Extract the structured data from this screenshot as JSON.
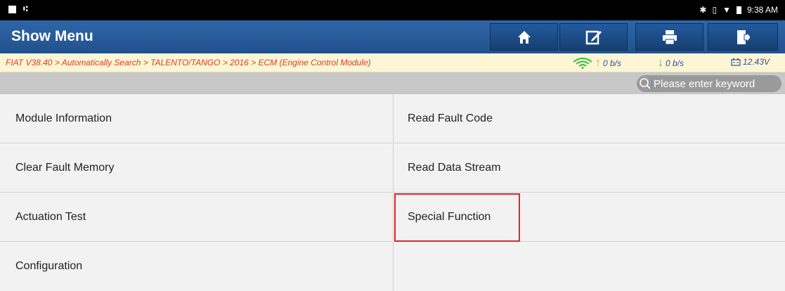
{
  "statusbar": {
    "time": "9:38 AM"
  },
  "header": {
    "title": "Show Menu",
    "buttons": [
      {
        "name": "home",
        "icon": "home-icon"
      },
      {
        "name": "edit",
        "icon": "edit-icon"
      },
      {
        "name": "print",
        "icon": "printer-icon"
      },
      {
        "name": "exit",
        "icon": "exit-icon"
      }
    ]
  },
  "breadcrumb": "FIAT V38.40 > Automatically Search > TALENTO/TANGO > 2016 > ECM (Engine Control Module)",
  "network": {
    "upload": "0 b/s",
    "download": "0 b/s",
    "voltage": "12.43V"
  },
  "search": {
    "placeholder": "Please enter keyword"
  },
  "menu": {
    "items": [
      {
        "label": "Module Information"
      },
      {
        "label": "Read Fault Code"
      },
      {
        "label": "Clear Fault Memory"
      },
      {
        "label": "Read Data Stream"
      },
      {
        "label": "Actuation Test"
      },
      {
        "label": "Special Function"
      },
      {
        "label": "Configuration"
      },
      {
        "label": ""
      }
    ]
  },
  "colors": {
    "header": "#21518c",
    "breadcrumb_text": "#e23a1f",
    "highlight": "#e3242b"
  }
}
